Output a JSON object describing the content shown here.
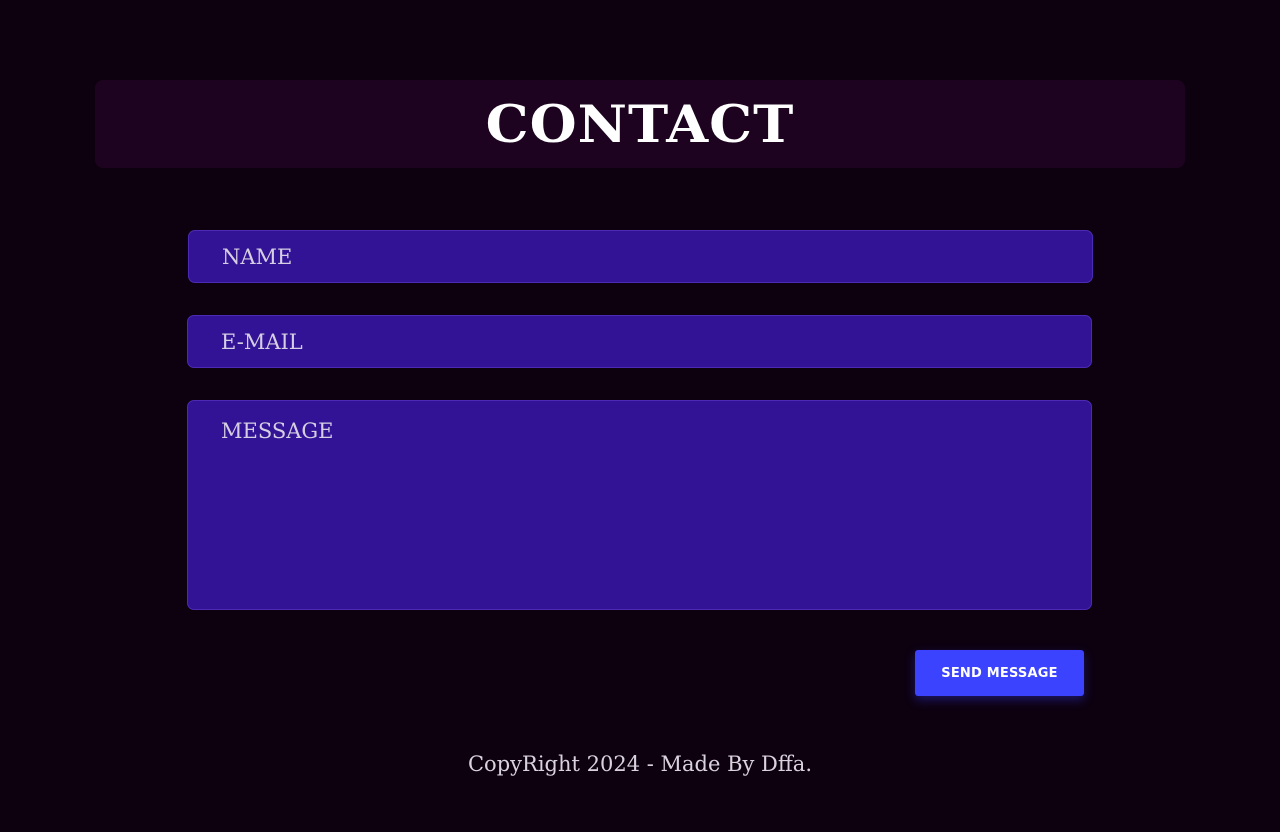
{
  "header": {
    "title": "CONTACT"
  },
  "form": {
    "name_placeholder": "NAME",
    "name_value": "",
    "email_placeholder": "E-MAIL",
    "email_value": "",
    "message_placeholder": "MESSAGE",
    "message_value": "",
    "send_label": "SEND MESSAGE"
  },
  "footer": {
    "text": "CopyRight 2024 - Made By Dffa."
  },
  "colors": {
    "background": "#0d0110",
    "header_bg": "#1d0320",
    "field_bg": "#321396",
    "button_bg": "#3b43ff"
  }
}
